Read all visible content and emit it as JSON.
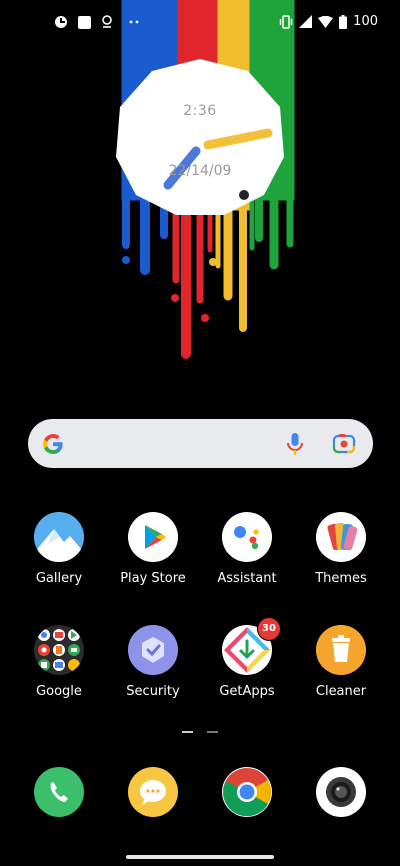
{
  "status_bar": {
    "battery_level": "100",
    "left_icons": [
      "app-notification-icon",
      "square-notification-icon",
      "location-pin-icon",
      "more-dots-icon"
    ],
    "right_icons": [
      "vibrate-icon",
      "signal-icon",
      "wifi-icon",
      "battery-icon"
    ]
  },
  "clock_widget": {
    "time": "2:36",
    "date": "22/14/09"
  },
  "search": {
    "icons": [
      "google-logo-icon",
      "mic-icon",
      "lens-icon"
    ]
  },
  "apps": [
    {
      "label": "Gallery"
    },
    {
      "label": "Play Store"
    },
    {
      "label": "Assistant"
    },
    {
      "label": "Themes"
    },
    {
      "label": "Google"
    },
    {
      "label": "Security"
    },
    {
      "label": "GetApps",
      "badge": "30"
    },
    {
      "label": "Cleaner"
    }
  ],
  "dock": [
    {
      "name": "phone"
    },
    {
      "name": "messages"
    },
    {
      "name": "chrome"
    },
    {
      "name": "camera"
    }
  ],
  "colors": {
    "blue": "#1b5bd0",
    "red": "#e0262b",
    "yellow": "#f2bd2c",
    "green": "#1fa33b"
  }
}
